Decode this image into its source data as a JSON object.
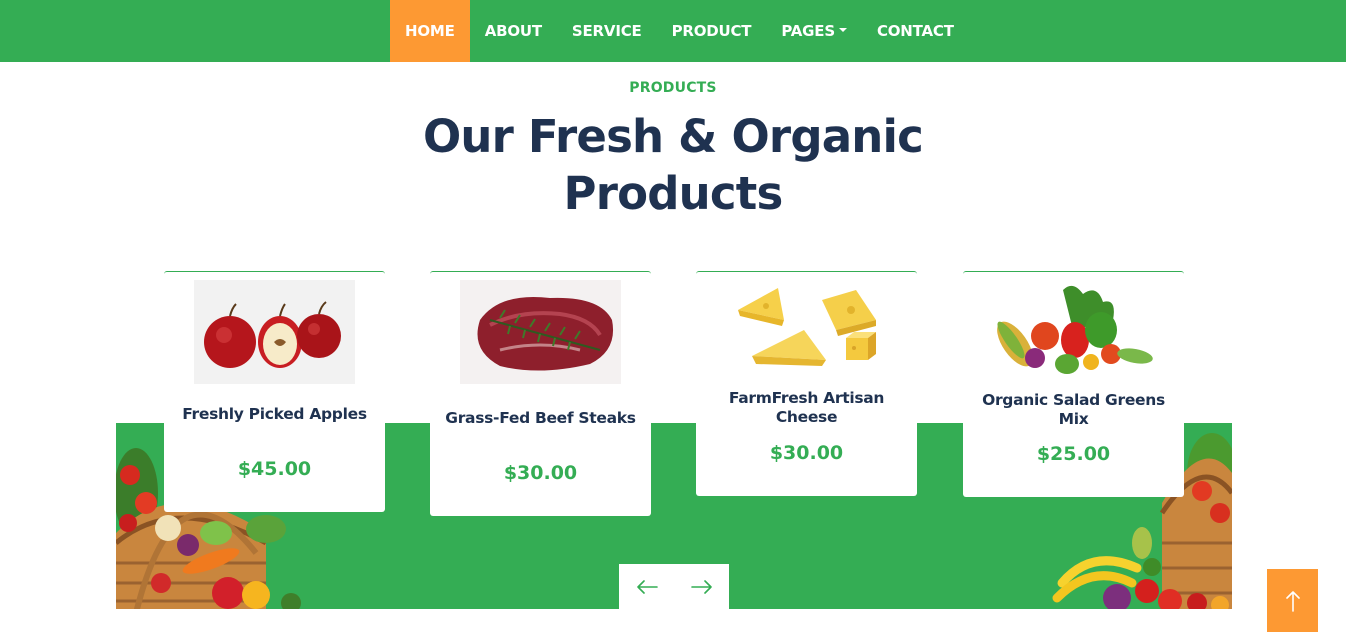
{
  "nav": {
    "items": [
      {
        "label": "HOME",
        "active": true
      },
      {
        "label": "ABOUT"
      },
      {
        "label": "SERVICE"
      },
      {
        "label": "PRODUCT"
      },
      {
        "label": "PAGES",
        "dropdown": true
      },
      {
        "label": "CONTACT"
      }
    ]
  },
  "section": {
    "subtitle": "PRODUCTS",
    "title_line1": "Our Fresh & Organic",
    "title_line2": "Products"
  },
  "products": [
    {
      "name": "Freshly Picked Apples",
      "price": "$45.00",
      "image": "apples-image"
    },
    {
      "name": "Grass-Fed Beef Steaks",
      "price": "$30.00",
      "image": "beef-steak-image"
    },
    {
      "name": "FarmFresh Artisan Cheese",
      "price": "$30.00",
      "image": "cheese-image"
    },
    {
      "name": "Organic Salad Greens Mix",
      "price": "$25.00",
      "image": "vegetables-image"
    }
  ],
  "carousel": {
    "prev_icon": "arrow-left-icon",
    "next_icon": "arrow-right-icon"
  },
  "back_to_top": {
    "icon": "arrow-up-icon"
  },
  "colors": {
    "primary_green": "#34ad54",
    "accent_orange": "#fd9933",
    "heading_navy": "#1f3250"
  }
}
